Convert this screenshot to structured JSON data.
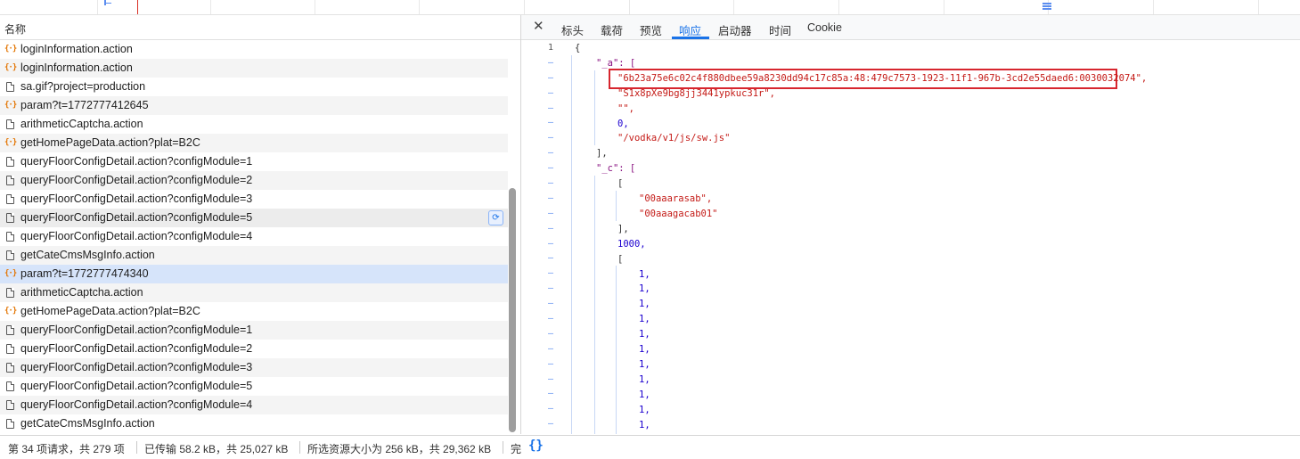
{
  "list": {
    "header": "名称",
    "rows": [
      {
        "name": "loginInformation.action",
        "type": "xhr"
      },
      {
        "name": "loginInformation.action",
        "type": "xhr"
      },
      {
        "name": "sa.gif?project=production",
        "type": "doc"
      },
      {
        "name": "param?t=1772777412645",
        "type": "xhr"
      },
      {
        "name": "arithmeticCaptcha.action",
        "type": "doc"
      },
      {
        "name": "getHomePageData.action?plat=B2C",
        "type": "xhr"
      },
      {
        "name": "queryFloorConfigDetail.action?configModule=1",
        "type": "doc"
      },
      {
        "name": "queryFloorConfigDetail.action?configModule=2",
        "type": "doc"
      },
      {
        "name": "queryFloorConfigDetail.action?configModule=3",
        "type": "doc"
      },
      {
        "name": "queryFloorConfigDetail.action?configModule=5",
        "type": "doc"
      },
      {
        "name": "queryFloorConfigDetail.action?configModule=4",
        "type": "doc"
      },
      {
        "name": "getCateCmsMsgInfo.action",
        "type": "doc"
      },
      {
        "name": "param?t=1772777474340",
        "type": "xhr"
      },
      {
        "name": "arithmeticCaptcha.action",
        "type": "doc"
      },
      {
        "name": "getHomePageData.action?plat=B2C",
        "type": "xhr"
      },
      {
        "name": "queryFloorConfigDetail.action?configModule=1",
        "type": "doc"
      },
      {
        "name": "queryFloorConfigDetail.action?configModule=2",
        "type": "doc"
      },
      {
        "name": "queryFloorConfigDetail.action?configModule=3",
        "type": "doc"
      },
      {
        "name": "queryFloorConfigDetail.action?configModule=5",
        "type": "doc"
      },
      {
        "name": "queryFloorConfigDetail.action?configModule=4",
        "type": "doc"
      },
      {
        "name": "getCateCmsMsgInfo.action",
        "type": "doc"
      }
    ],
    "selected_index": 12,
    "hover_index": 9,
    "xhr_icon": "{·}"
  },
  "tabs": {
    "close": "✕",
    "items": [
      "标头",
      "载荷",
      "预览",
      "响应",
      "启动器",
      "时间",
      "Cookie"
    ],
    "active": "响应"
  },
  "response": {
    "lines": [
      {
        "gutter": "1",
        "text": "{",
        "indent": 0,
        "cls": "p"
      },
      {
        "gutter": "–",
        "text": "\"_a\": [",
        "indent": 1,
        "cls": "k"
      },
      {
        "gutter": "–",
        "text": "\"6b23a75e6c02c4f880dbee59a8230dd94c17c85a:48:479c7573-1923-11f1-967b-3cd2e55daed6:0030032074\",",
        "indent": 2,
        "cls": "s"
      },
      {
        "gutter": "–",
        "text": "\"S1x8pXe9bg8jj3441ypkuc31r\",",
        "indent": 2,
        "cls": "s"
      },
      {
        "gutter": "–",
        "text": "\"\",",
        "indent": 2,
        "cls": "s"
      },
      {
        "gutter": "–",
        "text": "0,",
        "indent": 2,
        "cls": "n"
      },
      {
        "gutter": "–",
        "text": "\"/vodka/v1/js/sw.js\"",
        "indent": 2,
        "cls": "s"
      },
      {
        "gutter": "–",
        "text": "],",
        "indent": 1,
        "cls": "p"
      },
      {
        "gutter": "–",
        "text": "\"_c\": [",
        "indent": 1,
        "cls": "k"
      },
      {
        "gutter": "–",
        "text": "[",
        "indent": 2,
        "cls": "p"
      },
      {
        "gutter": "–",
        "text": "\"00aaarasab\",",
        "indent": 3,
        "cls": "s"
      },
      {
        "gutter": "–",
        "text": "\"00aaagacab01\"",
        "indent": 3,
        "cls": "s"
      },
      {
        "gutter": "–",
        "text": "],",
        "indent": 2,
        "cls": "p"
      },
      {
        "gutter": "–",
        "text": "1000,",
        "indent": 2,
        "cls": "n"
      },
      {
        "gutter": "–",
        "text": "[",
        "indent": 2,
        "cls": "p"
      },
      {
        "gutter": "–",
        "text": "1,",
        "indent": 3,
        "cls": "n"
      },
      {
        "gutter": "–",
        "text": "1,",
        "indent": 3,
        "cls": "n"
      },
      {
        "gutter": "–",
        "text": "1,",
        "indent": 3,
        "cls": "n"
      },
      {
        "gutter": "–",
        "text": "1,",
        "indent": 3,
        "cls": "n"
      },
      {
        "gutter": "–",
        "text": "1,",
        "indent": 3,
        "cls": "n"
      },
      {
        "gutter": "–",
        "text": "1,",
        "indent": 3,
        "cls": "n"
      },
      {
        "gutter": "–",
        "text": "1,",
        "indent": 3,
        "cls": "n"
      },
      {
        "gutter": "–",
        "text": "1,",
        "indent": 3,
        "cls": "n"
      },
      {
        "gutter": "–",
        "text": "1,",
        "indent": 3,
        "cls": "n"
      },
      {
        "gutter": "–",
        "text": "1,",
        "indent": 3,
        "cls": "n"
      },
      {
        "gutter": "–",
        "text": "1,",
        "indent": 3,
        "cls": "n"
      }
    ]
  },
  "status": {
    "requests": "第 34 项请求，共 279 项",
    "transferred": "已传输 58.2 kB，共 25,027 kB",
    "resources": "所选资源大小为 256 kB，共 29,362 kB",
    "finish": "完",
    "format_icon": "{}"
  },
  "colors": {
    "accent": "#1a73e8",
    "selected_row": "#d6e4fa",
    "highlight_box": "#d7262e"
  }
}
